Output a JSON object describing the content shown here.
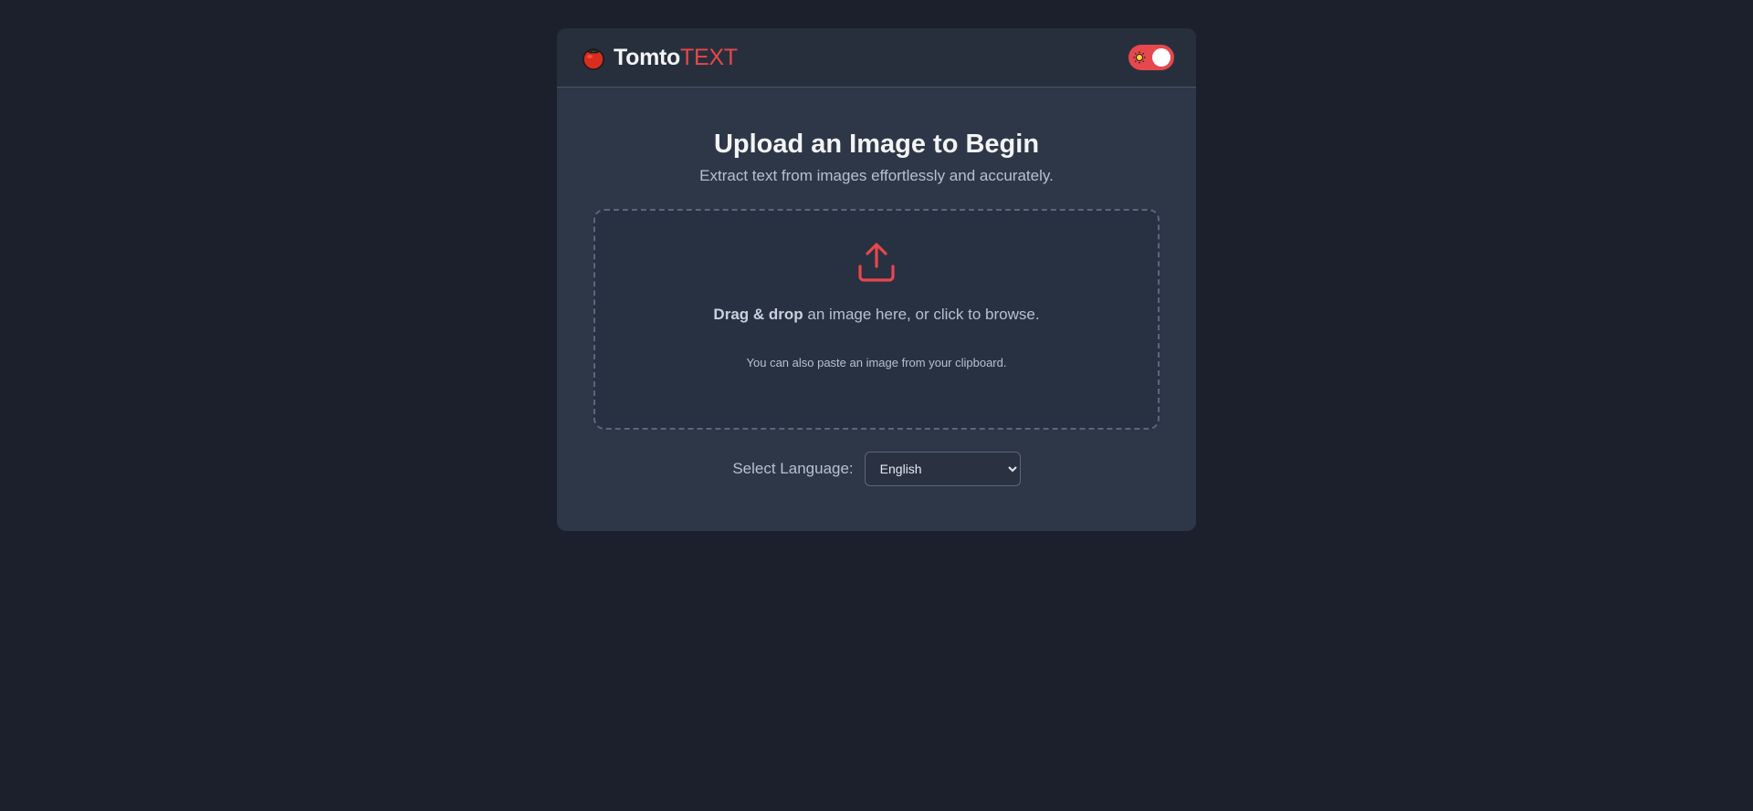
{
  "header": {
    "brand_primary": "Tomto",
    "brand_accent": "TEXT",
    "brand_icon": "tomato-icon",
    "theme_toggle_icon": "sun-icon"
  },
  "main": {
    "title": "Upload an Image to Begin",
    "subtitle": "Extract text from images effortlessly and accurately.",
    "dropzone": {
      "icon": "upload-icon",
      "bold_text": "Drag & drop",
      "rest_text": " an image here, or click to browse.",
      "paste_hint": "You can also paste an image from your clipboard."
    },
    "language": {
      "label": "Select Language:",
      "selected": "English"
    }
  },
  "colors": {
    "background": "#1b202c",
    "card": "#2d3748",
    "accent": "#e5484d"
  }
}
